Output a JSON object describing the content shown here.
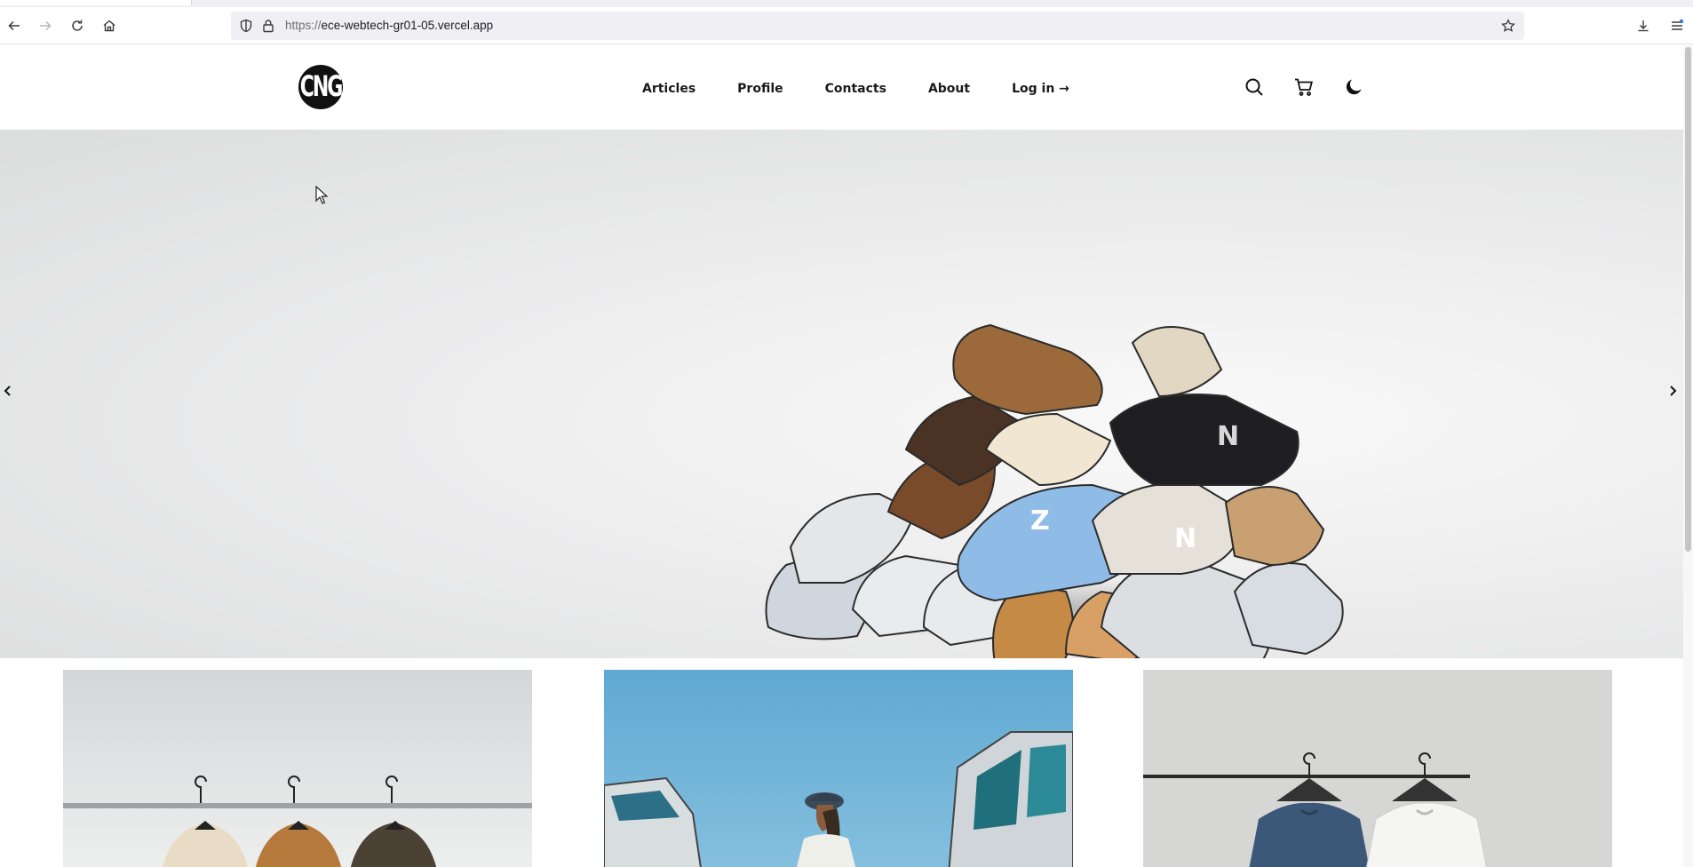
{
  "browser": {
    "url_scheme": "https://",
    "url_host": "ece-webtech-gr01-05.vercel.app",
    "icons": {
      "back": "back-arrow-icon",
      "forward": "forward-arrow-icon",
      "reload": "reload-icon",
      "home": "home-icon",
      "tracking": "shield-icon",
      "lock": "lock-icon",
      "bookmark": "star-icon",
      "downloads": "download-icon",
      "menu": "menu-icon"
    }
  },
  "site": {
    "logo_text": "CNG",
    "nav": [
      {
        "label": "Articles"
      },
      {
        "label": "Profile"
      },
      {
        "label": "Contacts"
      },
      {
        "label": "About"
      },
      {
        "label": "Log in →"
      }
    ],
    "header_icons": [
      "search-icon",
      "cart-icon",
      "moon-icon"
    ]
  },
  "hero": {
    "image": "pile of sneakers",
    "controls": [
      "chevron-left-icon",
      "chevron-right-icon"
    ]
  },
  "cards": [
    {
      "image": "puffer jackets on hangers"
    },
    {
      "image": "person in cap beside vehicle"
    },
    {
      "image": "t-shirts on hangers"
    }
  ],
  "colors": {
    "text": "#111111",
    "background": "#ffffff",
    "sky": "#6fb3d6",
    "url_bar": "#f0f0f4"
  }
}
